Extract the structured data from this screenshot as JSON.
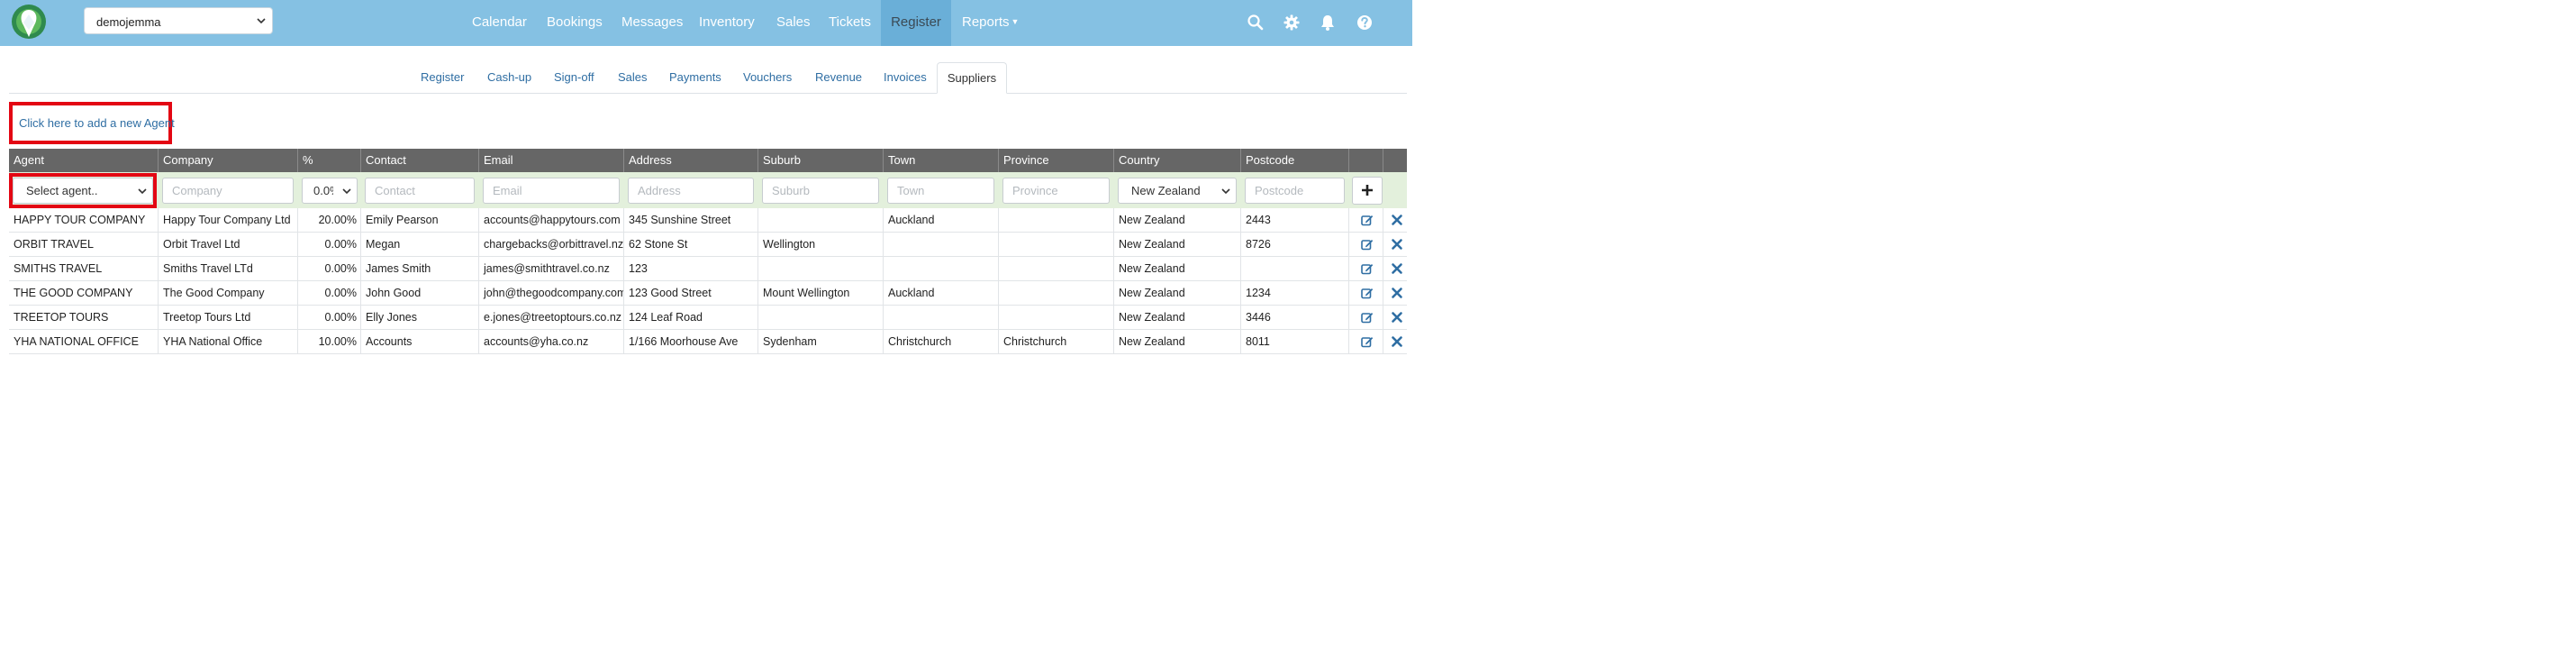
{
  "header": {
    "tenant": "demojemma",
    "nav": [
      {
        "label": "Calendar"
      },
      {
        "label": "Bookings"
      },
      {
        "label": "Messages"
      },
      {
        "label": "Inventory"
      },
      {
        "label": "Sales"
      },
      {
        "label": "Tickets"
      },
      {
        "label": "Register"
      },
      {
        "label": "Reports"
      }
    ],
    "active_nav": "Register",
    "icons": [
      "search-icon",
      "gear-icon",
      "bell-icon",
      "help-icon"
    ]
  },
  "subtabs": [
    "Register",
    "Cash-up",
    "Sign-off",
    "Sales",
    "Payments",
    "Vouchers",
    "Revenue",
    "Invoices",
    "Suppliers"
  ],
  "active_subtab": "Suppliers",
  "add_agent_link": "Click here to add a new Agent",
  "table": {
    "columns": [
      "Agent",
      "Company",
      "%",
      "Contact",
      "Email",
      "Address",
      "Suburb",
      "Town",
      "Province",
      "Country",
      "Postcode"
    ],
    "filters": {
      "agent": "Select agent..",
      "company": "Company",
      "percent": "0.0%",
      "contact": "Contact",
      "email": "Email",
      "address": "Address",
      "suburb": "Suburb",
      "town": "Town",
      "province": "Province",
      "country": "New Zealand",
      "postcode": "Postcode"
    },
    "rows": [
      [
        "HAPPY TOUR COMPANY",
        "Happy Tour Company Ltd",
        "20.00%",
        "Emily Pearson",
        "accounts@happytours.com",
        "345 Sunshine Street",
        "",
        "Auckland",
        "",
        "New Zealand",
        "2443"
      ],
      [
        "ORBIT TRAVEL",
        "Orbit Travel Ltd",
        "0.00%",
        "Megan",
        "chargebacks@orbittravel.nz",
        "62 Stone St",
        "Wellington",
        "",
        "",
        "New Zealand",
        "8726"
      ],
      [
        "SMITHS TRAVEL",
        "Smiths Travel LTd",
        "0.00%",
        "James Smith",
        "james@smithtravel.co.nz",
        "123",
        "",
        "",
        "",
        "New Zealand",
        ""
      ],
      [
        "THE GOOD COMPANY",
        "The Good Company",
        "0.00%",
        "John Good",
        "john@thegoodcompany.com",
        "123 Good Street",
        "Mount Wellington",
        "Auckland",
        "",
        "New Zealand",
        "1234"
      ],
      [
        "TREETOP TOURS",
        "Treetop Tours Ltd",
        "0.00%",
        "Elly Jones",
        "e.jones@treetoptours.co.nz",
        "124 Leaf Road",
        "",
        "",
        "",
        "New Zealand",
        "3446"
      ],
      [
        "YHA NATIONAL OFFICE",
        "YHA National Office",
        "10.00%",
        "Accounts",
        "accounts@yha.co.nz",
        "1/166 Moorhouse Ave",
        "Sydenham",
        "Christchurch",
        "Christchurch",
        "New Zealand",
        "8011"
      ]
    ]
  },
  "colors": {
    "navbar": "#85c1e3",
    "nav_active": "#6aafd8",
    "table_header": "#666666",
    "filter_row": "#e3f0dc",
    "link": "#2f6ea3",
    "highlight": "#e30613",
    "action_icon": "#2f6ea3"
  }
}
